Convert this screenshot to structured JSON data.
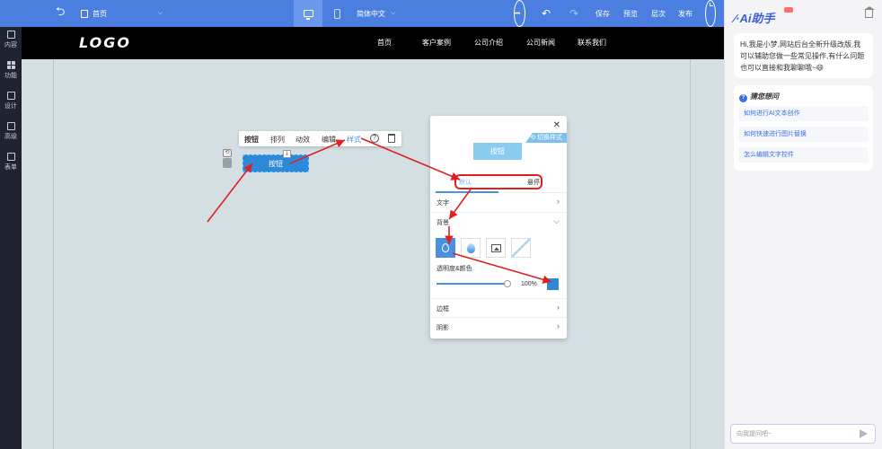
{
  "topbar": {
    "page_name": "首页",
    "language": "简体中文",
    "save": "保存",
    "preview": "预览",
    "layers": "层次",
    "publish": "发布"
  },
  "sidebar": {
    "items": [
      {
        "label": "内容",
        "icon": "document-icon"
      },
      {
        "label": "功能",
        "icon": "grid-icon"
      },
      {
        "label": "设计",
        "icon": "layout-icon"
      },
      {
        "label": "高级",
        "icon": "monitor-icon"
      },
      {
        "label": "表单",
        "icon": "form-icon"
      }
    ]
  },
  "site": {
    "logo": "LOGO",
    "nav": [
      "首页",
      "客户案例",
      "公司介绍",
      "公司新闻",
      "联系我们"
    ]
  },
  "element_toolbar": {
    "items": [
      "按钮",
      "排列",
      "动效",
      "编辑",
      "样式"
    ],
    "help": "?"
  },
  "selected_button": {
    "label": "按钮"
  },
  "style_panel": {
    "ribbon": "切换样式",
    "preview_label": "按钮",
    "tab_default": "默认",
    "tab_hover": "悬停",
    "text_section": "文字",
    "background_section": "背景",
    "background_options": [
      "color-fill-icon",
      "gradient-icon",
      "image-icon",
      "none-icon"
    ],
    "opacity_label": "透明度&颜色",
    "opacity_value": "100%",
    "opacity_fraction": 1.0,
    "color": "#2e8ad8",
    "border_section": "边框",
    "shadow_section": "阴影"
  },
  "ai_panel": {
    "title": "Ai助手",
    "greeting": "Hi,我是小梦,网站后台全新升级改版,我可以辅助您做一些常见操作,有什么问题也可以直接和我聊聊哦~😄",
    "guess_title": "猜您想问",
    "questions": [
      "如何进行AI文本创作",
      "如何快速进行图片替换",
      "怎么编辑文字控件"
    ],
    "input_placeholder": "向我提问吧~"
  }
}
